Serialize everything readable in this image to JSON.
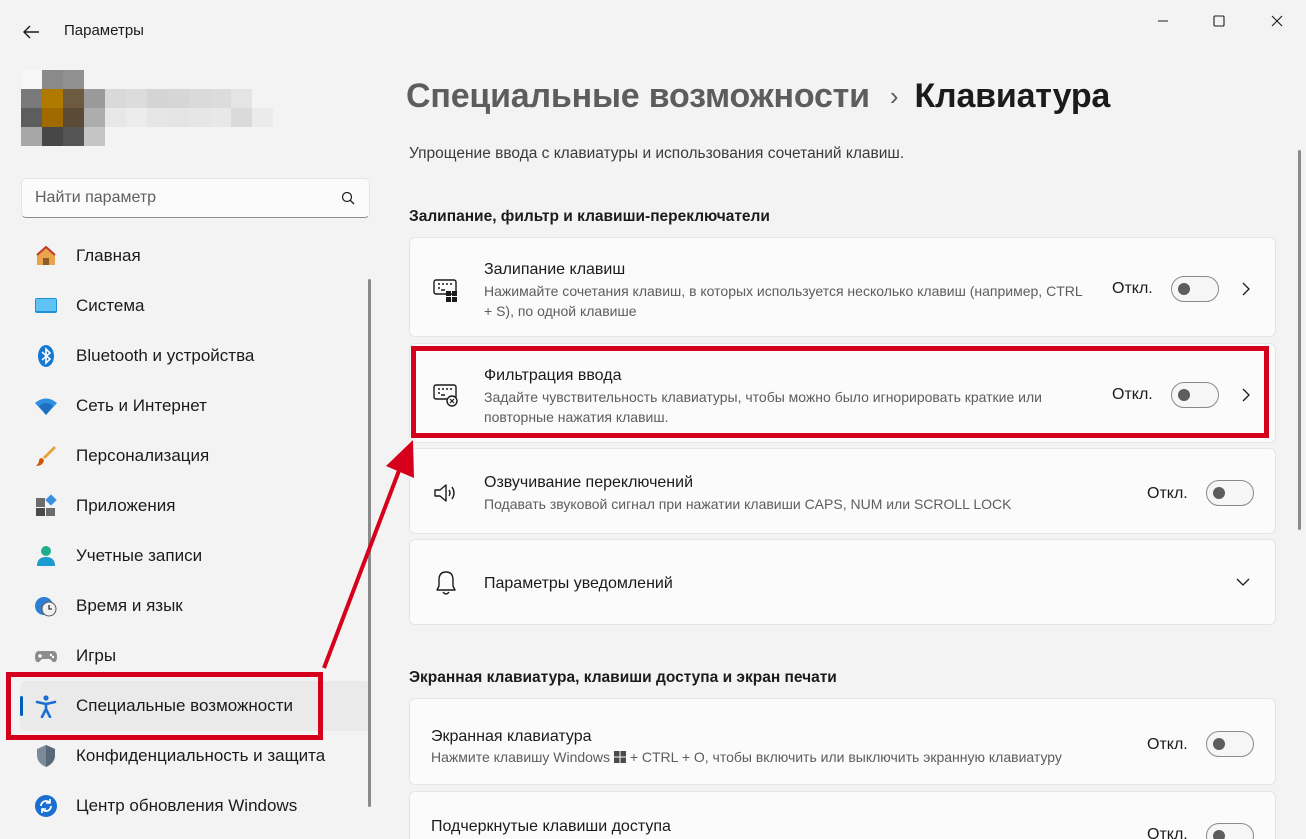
{
  "window": {
    "title": "Параметры",
    "back_icon": "arrow-left-icon",
    "controls": [
      "minimize-icon",
      "maximize-icon",
      "close-icon"
    ]
  },
  "avatar": {
    "description": "pixelated user avatar",
    "colors": [
      [
        "#f6f6f6",
        "#8a8a8a",
        "#909090",
        "#f3f3f3",
        "#f3f3f3",
        "#f3f3f3",
        "#f3f3f3",
        "#f3f3f3",
        "#f3f3f3",
        "#f3f3f3",
        "#f3f3f3",
        "#f3f3f3"
      ],
      [
        "#7a7a7a",
        "#b07a00",
        "#6e5a3e",
        "#9a9a9a",
        "#d9d9d9",
        "#dcdcdc",
        "#d4d4d4",
        "#d6d6d6",
        "#dadada",
        "#dcdcdc",
        "#e4e4e4",
        "#f3f3f3"
      ],
      [
        "#5d5d5d",
        "#a06a00",
        "#5a4a36",
        "#adadad",
        "#e7e7e7",
        "#ececec",
        "#e6e6e6",
        "#e4e4e4",
        "#e6e6e6",
        "#e8e8e8",
        "#dadada",
        "#ebebeb"
      ],
      [
        "#a7a7a7",
        "#474747",
        "#555555",
        "#c5c5c5",
        "#f3f3f3",
        "#f3f3f3",
        "#f3f3f3",
        "#f3f3f3",
        "#f3f3f3",
        "#f3f3f3",
        "#f3f3f3",
        "#f3f3f3"
      ]
    ]
  },
  "search": {
    "placeholder": "Найти параметр",
    "value": "",
    "icon": "search-icon"
  },
  "sidebar": {
    "items": [
      {
        "label": "Главная",
        "icon": "home-icon",
        "active": false
      },
      {
        "label": "Система",
        "icon": "monitor-icon",
        "active": false
      },
      {
        "label": "Bluetooth и устройства",
        "icon": "bluetooth-icon",
        "active": false
      },
      {
        "label": "Сеть и Интернет",
        "icon": "wifi-icon",
        "active": false
      },
      {
        "label": "Персонализация",
        "icon": "brush-icon",
        "active": false
      },
      {
        "label": "Приложения",
        "icon": "apps-icon",
        "active": false
      },
      {
        "label": "Учетные записи",
        "icon": "person-icon",
        "active": false
      },
      {
        "label": "Время и язык",
        "icon": "clock-globe-icon",
        "active": false
      },
      {
        "label": "Игры",
        "icon": "gamepad-icon",
        "active": false
      },
      {
        "label": "Специальные возможности",
        "icon": "accessibility-icon",
        "active": true
      },
      {
        "label": "Конфиденциальность и защита",
        "icon": "shield-icon",
        "active": false
      },
      {
        "label": "Центр обновления Windows",
        "icon": "update-icon",
        "active": false
      }
    ]
  },
  "main": {
    "breadcrumb": {
      "parent": "Специальные возможности",
      "separator": "›",
      "current": "Клавиатура"
    },
    "description": "Упрощение ввода с клавиатуры и использования сочетаний клавиш.",
    "sections": [
      {
        "title": "Залипание, фильтр и клавиши-переключатели",
        "cards": [
          {
            "icon": "sticky-keys-icon",
            "title": "Залипание клавиш",
            "desc": "Нажимайте сочетания клавиш, в которых используется несколько клавиш (например, CTRL + S), по одной клавише",
            "state": "Откл.",
            "toggle_on": false,
            "chevron": "chevron-right-icon"
          },
          {
            "icon": "filter-keys-icon",
            "title": "Фильтрация ввода",
            "desc": "Задайте чувствительность клавиатуры, чтобы можно было игнорировать краткие или повторные нажатия клавиш.",
            "state": "Откл.",
            "toggle_on": false,
            "chevron": "chevron-right-icon"
          },
          {
            "icon": "speaker-icon",
            "title": "Озвучивание переключений",
            "desc": "Подавать звуковой сигнал при нажатии клавиши CAPS, NUM или SCROLL LOCK",
            "state": "Откл.",
            "toggle_on": false
          },
          {
            "icon": "bell-icon",
            "title": "Параметры уведомлений",
            "chevron": "chevron-down-icon"
          }
        ]
      },
      {
        "title": "Экранная клавиатура, клавиши доступа и экран печати",
        "cards": [
          {
            "title": "Экранная клавиатура",
            "desc_pre": "Нажмите клавишу Windows",
            "desc_post": "+ CTRL + O, чтобы включить или выключить экранную клавиатуру",
            "desc_icon": "windows-logo-icon",
            "state": "Откл.",
            "toggle_on": false
          },
          {
            "title": "Подчеркнутые клавиши доступа",
            "state": "Откл.",
            "toggle_on": false
          }
        ]
      }
    ]
  },
  "colors": {
    "accent": "#005fb8",
    "annotation": "#d6001c",
    "background": "#f3f3f3",
    "card": "#fbfbfb"
  }
}
